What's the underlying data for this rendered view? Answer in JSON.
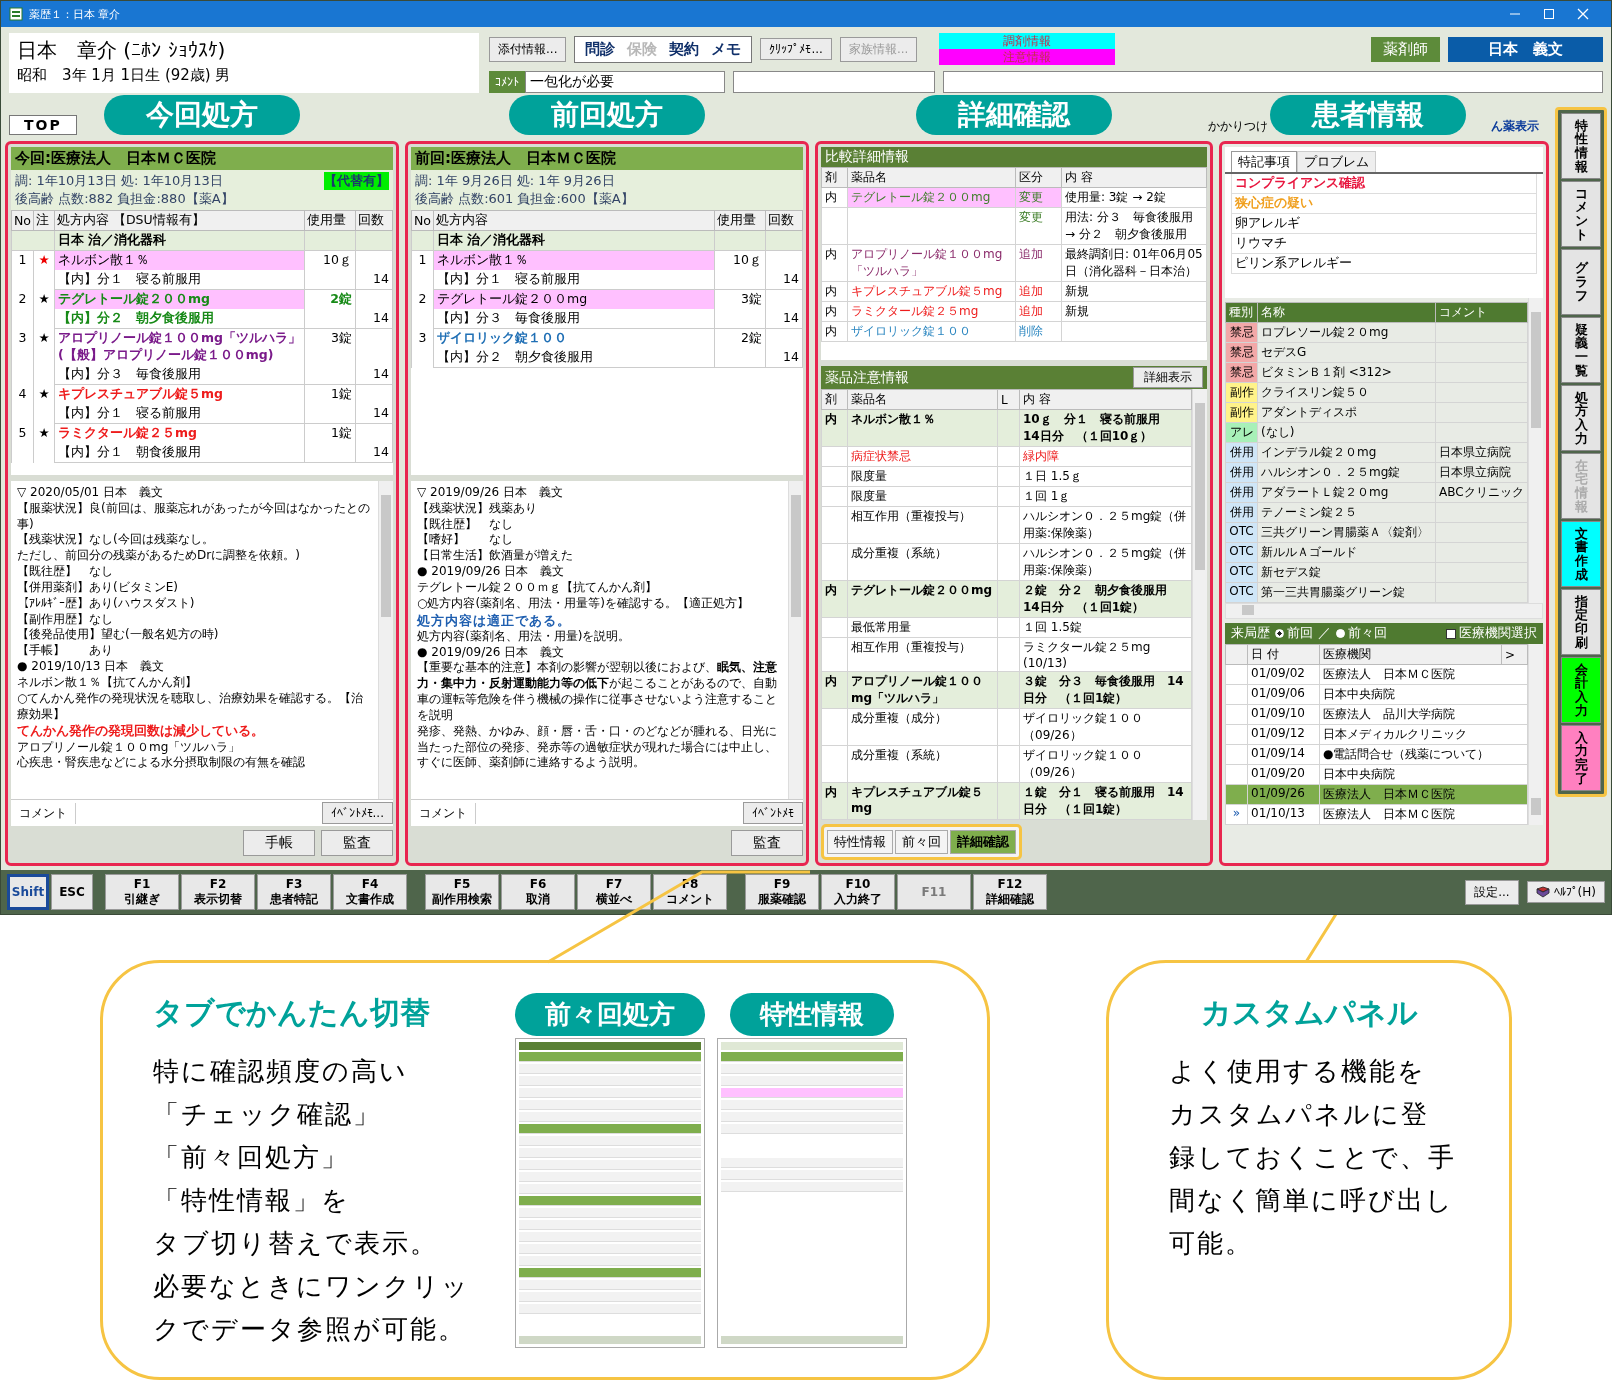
{
  "window": {
    "title": "薬歴１：日本 章介"
  },
  "patient": {
    "name": "日本　章介 (ﾆﾎﾝ ｼｮｳｽｹ)",
    "birth": "昭和　3年 1月 1日生 (92歳) 男"
  },
  "attach_button": {
    "label": "添付情報..."
  },
  "record_tabs": [
    {
      "label": "問診",
      "disabled": false
    },
    {
      "label": "保険",
      "disabled": true
    },
    {
      "label": "契約",
      "disabled": false
    },
    {
      "label": "メモ",
      "disabled": false
    }
  ],
  "memo_buttons": [
    {
      "label": "ｸﾘｯﾌﾟﾒﾓ...",
      "disabled": false
    },
    {
      "label": "家族情報...",
      "disabled": true
    }
  ],
  "alerts": [
    {
      "label": "調剤情報",
      "color": "#00ffff"
    },
    {
      "label": "注意情報",
      "color": "#ff00ff"
    }
  ],
  "comment": {
    "label": "ｺﾒﾝﾄ",
    "value": "一包化が必要"
  },
  "user": {
    "role": "薬剤師",
    "name": "日本　義文"
  },
  "top_tab": {
    "label": "TOP"
  },
  "top_links": [
    {
      "label": "かかりつけ",
      "kind": "plain"
    },
    {
      "label": "ん薬表示",
      "kind": "link"
    }
  ],
  "current_rx": {
    "callout": "今回処方",
    "title": "今回:医療法人　日本ＭＣ医院",
    "dates": "調: 1年10月13日 処: 1年10月13日",
    "totals": "後高齢 点数:882 負担金:880【薬A】",
    "badge": "【代替有】",
    "columns": [
      "No",
      "注",
      "処方内容 【DSU情報有】",
      "使用量",
      "回数"
    ],
    "department": "日本 治／消化器科",
    "items": [
      {
        "no": "1",
        "star": "★",
        "star_alert": true,
        "name": [
          "ネルボン散１％"
        ],
        "bold": false,
        "highlight": true,
        "dose": "10ｇ",
        "usage": "【内】分１　寝る前服用",
        "usage_emphasis": false,
        "days": "14"
      },
      {
        "no": "2",
        "star": "★",
        "star_alert": false,
        "name": [
          "テグレトール錠２００mg"
        ],
        "color": "#178a17",
        "bold": true,
        "highlight": true,
        "dose": "2錠",
        "usage": "【内】分２　朝夕食後服用",
        "usage_emphasis": true,
        "days": "14"
      },
      {
        "no": "3",
        "star": "★",
        "star_alert": false,
        "name": [
          "アロプリノール錠１００mg「ツルハラ」",
          "(【般】アロプリノール錠１００mg)"
        ],
        "color": "#7a1a8a",
        "bold": true,
        "highlight": false,
        "dose": "3錠",
        "usage": "【内】分３　毎食後服用",
        "usage_emphasis": false,
        "days": "14"
      },
      {
        "no": "4",
        "star": "★",
        "star_alert": false,
        "name": [
          "キプレスチュアブル錠５mg"
        ],
        "color": "#ee1c1c",
        "bold": true,
        "highlight": false,
        "dose": "1錠",
        "usage": "【内】分１　寝る前服用",
        "usage_emphasis": false,
        "days": "14"
      },
      {
        "no": "5",
        "star": "★",
        "star_alert": false,
        "name": [
          "ラミクタール錠２５mg"
        ],
        "color": "#ee1c1c",
        "bold": true,
        "highlight": false,
        "dose": "1錠",
        "usage": "【内】分１　朝食後服用",
        "usage_emphasis": false,
        "days": "14"
      }
    ],
    "notes": [
      {
        "kind": "text",
        "text": "▽ 2020/05/01 日本　義文"
      },
      {
        "kind": "text",
        "text": "【服薬状況】良(前回は、服薬忘れがあったが今回はなかったとの事)"
      },
      {
        "kind": "text",
        "text": "【残薬状況】なし(今回は残薬なし。"
      },
      {
        "kind": "text",
        "text": "ただし、前回分の残薬があるためDrに調整を依頼。)"
      },
      {
        "kind": "text",
        "text": "【既往歴】　なし"
      },
      {
        "kind": "text",
        "text": "【併用薬剤】あり(ビタミンE)"
      },
      {
        "kind": "text",
        "text": "【ｱﾚﾙｷﾞｰ歴】あり(ハウスダスト)"
      },
      {
        "kind": "text",
        "text": "【副作用歴】なし"
      },
      {
        "kind": "text",
        "text": "【後発品使用】望む(一般名処方の時)"
      },
      {
        "kind": "text",
        "text": "【手帳】　　あり"
      },
      {
        "kind": "text",
        "text": "● 2019/10/13 日本　義文"
      },
      {
        "kind": "text",
        "text": "ネルボン散１％【抗てんかん剤】"
      },
      {
        "kind": "text",
        "text": "○てんかん発作の発現状況を聴取し、治療効果を確認する。【治療効果】"
      },
      {
        "kind": "alert",
        "text": "てんかん発作の発現回数は減少している。"
      },
      {
        "kind": "text",
        "text": "アロプリノール錠１００mg「ツルハラ」"
      },
      {
        "kind": "text",
        "text": "心疾患・腎疾患などによる水分摂取制限の有無を確認"
      }
    ],
    "comment_tab": "コメント",
    "memo_button": "ｲﾍﾞﾝﾄﾒﾓ...",
    "buttons": [
      "手帳",
      "監査"
    ]
  },
  "previous_rx": {
    "callout": "前回処方",
    "title": "前回:医療法人　日本ＭＣ医院",
    "dates": "調: 1年 9月26日 処: 1年 9月26日",
    "totals": "後高齢 点数:601 負担金:600【薬A】",
    "columns": [
      "No",
      "処方内容",
      "使用量",
      "回数"
    ],
    "department": "日本 治／消化器科",
    "items": [
      {
        "no": "1",
        "name": [
          "ネルボン散１％"
        ],
        "bold": false,
        "highlight": true,
        "dose": "10ｇ",
        "usage": "【内】分１　寝る前服用",
        "usage_emphasis": false,
        "days": "14"
      },
      {
        "no": "2",
        "name": [
          "テグレトール錠２００mg"
        ],
        "bold": false,
        "highlight": true,
        "dose": "3錠",
        "usage": "【内】分３　毎食後服用",
        "usage_emphasis": false,
        "days": "14"
      },
      {
        "no": "3",
        "name": [
          "ザイロリック錠１００"
        ],
        "color": "#1f6fb5",
        "bold": true,
        "highlight": false,
        "dose": "2錠",
        "usage": "【内】分２　朝夕食後服用",
        "usage_emphasis": false,
        "days": "14"
      }
    ],
    "notes": [
      {
        "kind": "text",
        "text": "▽ 2019/09/26 日本　義文"
      },
      {
        "kind": "text",
        "text": "【残薬状況】残薬あり"
      },
      {
        "kind": "text",
        "text": "【既往歴】　なし"
      },
      {
        "kind": "text",
        "text": "【嗜好】　　なし"
      },
      {
        "kind": "text",
        "text": "【日常生活】飲酒量が増えた"
      },
      {
        "kind": "text",
        "text": "● 2019/09/26 日本　義文"
      },
      {
        "kind": "small",
        "text": "テグレトール錠２００ｍｇ【抗てんかん剤】"
      },
      {
        "kind": "small",
        "text": "○処方内容(薬剤名、用法・用量等)を確認する。【適正処方】"
      },
      {
        "kind": "notice",
        "text": "処方内容は適正である。"
      },
      {
        "kind": "small",
        "text": "処方内容(薬剤名、用法・用量)を説明。"
      },
      {
        "kind": "text",
        "text": "● 2019/09/26 日本　義文"
      },
      {
        "kind": "warning",
        "text": "【重要な基本的注意】本剤の影響が翌朝以後におよび、**眠気、注意力・集中力・反射運動能力等の低下**が起こることがあるので、自動車の運転等危険を伴う機械の操作に従事させないよう注意することを説明"
      },
      {
        "kind": "small",
        "text": "発疹、発熱、かゆみ、顔・唇・舌・口・のどなどが腫れる、日光に当たった部位の発疹、発赤等の過敏症状が現れた場合には中止し、すぐに医師、薬剤師に連絡するよう説明。"
      }
    ],
    "comment_tab": "コメント",
    "memo_button": "ｲﾍﾞﾝﾄﾒﾓ",
    "buttons": [
      "監査"
    ]
  },
  "detail": {
    "callout": "詳細確認",
    "compare": {
      "title": "比較詳細情報",
      "columns": [
        "剤",
        "薬品名",
        "区分",
        "内 容"
      ],
      "rows": [
        {
          "type": "内",
          "name": "テグレトール錠２００mg",
          "category": "変更",
          "content": "使用量: 3錠 → 2錠",
          "color": "#3f7f2a",
          "highlight": true
        },
        {
          "type": "",
          "name": "",
          "category": "変更",
          "content": "用法: 分３　毎食後服用 → 分２　朝夕食後服用",
          "color": "#3f7f2a",
          "highlight": false
        },
        {
          "type": "内",
          "name": "アロプリノール錠１００mg「ツルハラ」",
          "category": "追加",
          "content": "最終調剤日: 01年06月05日（消化器科－日本治）",
          "color": "#8a2a6a",
          "highlight": false
        },
        {
          "type": "内",
          "name": "キプレスチュアブル錠５mg",
          "category": "追加",
          "content": "新規",
          "color": "#ee1c1c",
          "highlight": false
        },
        {
          "type": "内",
          "name": "ラミクタール錠２５mg",
          "category": "追加",
          "content": "新規",
          "color": "#ee1c1c",
          "highlight": false
        },
        {
          "type": "内",
          "name": "ザイロリック錠１００",
          "category": "削除",
          "content": "",
          "color": "#2a86c0",
          "highlight": false
        }
      ]
    },
    "caution": {
      "title": "薬品注意情報",
      "button": "詳細表示",
      "columns": [
        "剤",
        "薬品名",
        "L",
        "内 容"
      ],
      "rows": [
        {
          "kind": "drug",
          "type": "内",
          "name": "ネルボン散１％",
          "content": "10ｇ　分１　寝る前服用　14日分　（１回10ｇ）"
        },
        {
          "kind": "alert",
          "type": "",
          "name": "病症状禁忌",
          "content": "緑内障"
        },
        {
          "kind": "item",
          "type": "",
          "name": "限度量",
          "content": "１日 1.5ｇ"
        },
        {
          "kind": "item",
          "type": "",
          "name": "限度量",
          "content": "１回 1ｇ"
        },
        {
          "kind": "item",
          "type": "",
          "name": "相互作用（重複投与）",
          "content": "ハルシオン０．２５mg錠（併用薬:保険薬）"
        },
        {
          "kind": "item",
          "type": "",
          "name": "成分重複（系統）",
          "content": "ハルシオン０．２５mg錠（併用薬:保険薬）"
        },
        {
          "kind": "drug",
          "type": "内",
          "name": "テグレトール錠２００mg",
          "content": "２錠　分２　朝夕食後服用　14日分　（１回1錠）"
        },
        {
          "kind": "item",
          "type": "",
          "name": "最低常用量",
          "content": "１回 1.5錠"
        },
        {
          "kind": "item",
          "type": "",
          "name": "相互作用（重複投与）",
          "content": "ラミクタール錠２５mg (10/13)"
        },
        {
          "kind": "drug",
          "type": "内",
          "name": "アロプリノール錠１００mg「ツルハラ」",
          "content": "３錠　分３　毎食後服用　14日分　（１回1錠）"
        },
        {
          "kind": "item",
          "type": "",
          "name": "成分重複（成分）",
          "content": "ザイロリック錠１００（09/26）"
        },
        {
          "kind": "item",
          "type": "",
          "name": "成分重複（系統）",
          "content": "ザイロリック錠１００（09/26）"
        },
        {
          "kind": "drug",
          "type": "内",
          "name": "キプレスチュアブル錠５mg",
          "content": "１錠　分１　寝る前服用　14日分　（１回1錠）"
        }
      ]
    },
    "tabs": [
      {
        "label": "特性情報",
        "selected": false
      },
      {
        "label": "前々回",
        "selected": false
      },
      {
        "label": "詳細確認",
        "selected": true
      }
    ]
  },
  "patient_info": {
    "callout": "患者情報",
    "tabs": [
      {
        "label": "特記事項",
        "selected": true
      },
      {
        "label": "プロブレム",
        "selected": false
      }
    ],
    "notes": [
      {
        "text": "コンプライアンス確認",
        "color": "#e8173f"
      },
      {
        "text": "狭心症の疑い",
        "color": "#f0a020"
      },
      {
        "text": "卵アレルギ"
      },
      {
        "text": "リウマチ"
      },
      {
        "text": "ピリン系アレルギー"
      }
    ],
    "drugs": {
      "columns": [
        "種別",
        "名称",
        "コメント"
      ],
      "rows": [
        {
          "type": "禁忌",
          "color": "#f2a8a8",
          "name": "ロプレソール錠２０mg",
          "comment": ""
        },
        {
          "type": "禁忌",
          "color": "#f2a8a8",
          "name": "セデスG",
          "comment": ""
        },
        {
          "type": "禁忌",
          "color": "#f2a8a8",
          "name": "ビタミンＢ１剤 <312>",
          "comment": ""
        },
        {
          "type": "副作",
          "color": "#fff38a",
          "name": "クライスリン錠５０",
          "comment": ""
        },
        {
          "type": "副作",
          "color": "#fff38a",
          "name": "アダントディスポ",
          "comment": ""
        },
        {
          "type": "アレ",
          "color": "#a8f0b8",
          "name": "(なし)",
          "comment": ""
        },
        {
          "type": "併用",
          "color": "#cfe6f7",
          "name": "インデラル錠２０mg",
          "comment": "日本県立病院"
        },
        {
          "type": "併用",
          "color": "#cfe6f7",
          "name": "ハルシオン０．２５mg錠",
          "comment": "日本県立病院"
        },
        {
          "type": "併用",
          "color": "#cfe6f7",
          "name": "アダラートＬ錠２０mg",
          "comment": "ABCクリニック"
        },
        {
          "type": "併用",
          "color": "#cfe6f7",
          "name": "テノーミン錠２５",
          "comment": ""
        },
        {
          "type": "OTC",
          "color": "#cfe6f7",
          "name": "三共グリーン胃腸薬Ａ〈錠剤〉",
          "comment": ""
        },
        {
          "type": "OTC",
          "color": "#cfe6f7",
          "name": "新ルルＡゴールド",
          "comment": ""
        },
        {
          "type": "OTC",
          "color": "#cfe6f7",
          "name": "新セデス錠",
          "comment": ""
        },
        {
          "type": "OTC",
          "color": "#cfe6f7",
          "name": "第一三共胃腸薬グリーン錠",
          "comment": ""
        }
      ]
    },
    "history": {
      "label": "来局歴",
      "radios": [
        {
          "label": "前回",
          "selected": true
        },
        {
          "label": "前々回",
          "selected": false
        }
      ],
      "separator": "／",
      "checkbox": {
        "label": "医療機関選択",
        "checked": false
      },
      "columns": [
        "日 付",
        "医療機関",
        ">"
      ],
      "rows": [
        {
          "date": "01/09/02",
          "clinic": "医療法人　日本ＭＣ医院",
          "selected": false,
          "marker": ""
        },
        {
          "date": "01/09/06",
          "clinic": "日本中央病院",
          "selected": false,
          "marker": ""
        },
        {
          "date": "01/09/10",
          "clinic": "医療法人　品川大学病院",
          "selected": false,
          "marker": ""
        },
        {
          "date": "01/09/12",
          "clinic": "日本メディカルクリニック",
          "selected": false,
          "marker": ""
        },
        {
          "date": "01/09/14",
          "clinic": "●電話問合せ（残薬について）",
          "selected": false,
          "marker": ""
        },
        {
          "date": "01/09/20",
          "clinic": "日本中央病院",
          "selected": false,
          "marker": ""
        },
        {
          "date": "01/09/26",
          "clinic": "医療法人　日本ＭＣ医院",
          "selected": true,
          "marker": ""
        },
        {
          "date": "01/10/13",
          "clinic": "医療法人　日本ＭＣ医院",
          "selected": false,
          "marker": "»"
        }
      ]
    }
  },
  "side_buttons": [
    {
      "label": "特性情報",
      "color": "#e4e4e4",
      "disabled": false
    },
    {
      "label": "コメント",
      "color": "#e4e4e4",
      "disabled": false
    },
    {
      "label": "グラフ",
      "color": "#e4e4e4",
      "disabled": false
    },
    {
      "label": "疑義一覧",
      "color": "#e4e4e4",
      "disabled": false
    },
    {
      "label": "処方入力",
      "color": "#e4e4e4",
      "disabled": false
    },
    {
      "label": "在宅情報",
      "color": "#e4e4e4",
      "disabled": true
    },
    {
      "label": "文書作成",
      "color": "#00ffff",
      "disabled": false
    },
    {
      "label": "指定印刷",
      "color": "#e4e4e4",
      "disabled": false
    },
    {
      "label": "会計入力",
      "color": "#00ff00",
      "disabled": false
    },
    {
      "label": "入力完了",
      "color": "#ff80c0",
      "disabled": false
    }
  ],
  "function_keys": [
    {
      "key": "Shift",
      "selected": true,
      "disabled": false
    },
    {
      "key": "ESC",
      "selected": false,
      "disabled": false
    },
    {
      "key": "F1",
      "label": "引継ぎ",
      "selected": false,
      "disabled": false
    },
    {
      "key": "F2",
      "label": "表示切替",
      "selected": false,
      "disabled": false
    },
    {
      "key": "F3",
      "label": "患者特記",
      "selected": false,
      "disabled": false
    },
    {
      "key": "F4",
      "label": "文書作成",
      "selected": false,
      "disabled": false
    },
    {
      "key": "F5",
      "label": "副作用検索",
      "selected": false,
      "disabled": false
    },
    {
      "key": "F6",
      "label": "取消",
      "selected": false,
      "disabled": false
    },
    {
      "key": "F7",
      "label": "横並べ",
      "selected": false,
      "disabled": false
    },
    {
      "key": "F8",
      "label": "コメント",
      "selected": false,
      "disabled": false
    },
    {
      "key": "F9",
      "label": "服薬確認",
      "selected": false,
      "disabled": false
    },
    {
      "key": "F10",
      "label": "入力終了",
      "selected": false,
      "disabled": false
    },
    {
      "key": "F11",
      "selected": false,
      "disabled": true
    },
    {
      "key": "F12",
      "label": "詳細確認",
      "selected": false,
      "disabled": false
    }
  ],
  "system_buttons": [
    {
      "label": "設定...",
      "kind": "plain"
    },
    {
      "label": "ﾍﾙﾌﾟ(H)",
      "kind": "help"
    }
  ],
  "feature_tabs": {
    "title": "タブでかんたん切替",
    "lines": [
      "特に確認頻度の高い",
      "「チェック確認」",
      "「前々回処方」",
      "「特性情報」を",
      "タブ切り替えで表示。",
      "必要なときにワンクリッ",
      "クでデータ参照が可能。"
    ],
    "thumbnails": [
      {
        "label": "前々回処方",
        "kind": "history"
      },
      {
        "label": "特性情報",
        "kind": "prescription"
      }
    ]
  },
  "feature_panel": {
    "title": "カスタムパネル",
    "lines": [
      "よく使用する機能を",
      "カスタムパネルに登",
      "録しておくことで、手",
      "間なく簡単に呼び出し",
      "可能。"
    ]
  }
}
